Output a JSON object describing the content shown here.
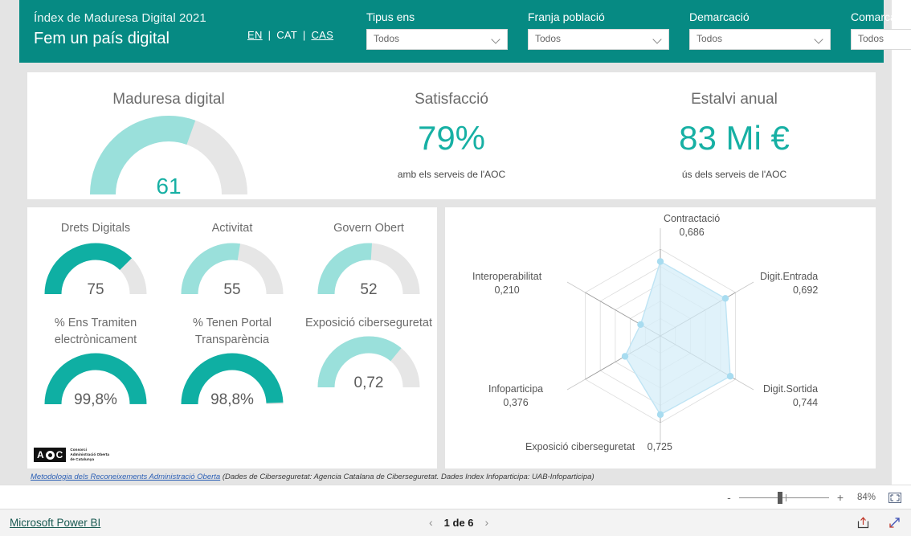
{
  "header": {
    "subtitle": "Índex de Maduresa Digital 2021",
    "title": "Fem un país digital",
    "languages": [
      {
        "code": "EN",
        "active": true
      },
      {
        "code": "CAT",
        "active": false
      },
      {
        "code": "CAS",
        "active": true
      }
    ],
    "separator": "|",
    "brand_color": "#068a83",
    "filters": [
      {
        "label": "Tipus ens",
        "value": "Todos"
      },
      {
        "label": "Franja població",
        "value": "Todos"
      },
      {
        "label": "Demarcació",
        "value": "Todos"
      },
      {
        "label": "Comarca",
        "value": "Todos"
      }
    ]
  },
  "kpis": [
    {
      "title": "Maduresa digital",
      "type": "gauge",
      "value": 61,
      "display": "61",
      "percent": 61,
      "color": "#9ae0db"
    },
    {
      "title": "Satisfacció",
      "type": "number",
      "display": "79%",
      "note": "amb els serveis de l'AOC",
      "color": "#17b0a4"
    },
    {
      "title": "Estalvi anual",
      "type": "number",
      "display": "83 Mi €",
      "note": "ús dels serveis de l'AOC",
      "color": "#17b0a4"
    }
  ],
  "gauges": [
    {
      "title": "Drets Digitals",
      "display": "75",
      "percent": 75,
      "color": "#0fafa3"
    },
    {
      "title": "Activitat",
      "display": "55",
      "percent": 55,
      "color": "#9ae0db"
    },
    {
      "title": "Govern Obert",
      "display": "52",
      "percent": 52,
      "color": "#9ae0db"
    },
    {
      "title": "% Ens Tramiten electrònicament",
      "display": "99,8%",
      "percent": 99.8,
      "color": "#0fafa3"
    },
    {
      "title": "% Tenen Portal Transparència",
      "display": "98,8%",
      "percent": 98.8,
      "color": "#0fafa3"
    },
    {
      "title": "Exposició ciberseguretat",
      "display": "0,72",
      "percent": 72,
      "color": "#9ae0db"
    }
  ],
  "logo": {
    "letters": [
      "A",
      "C"
    ],
    "line1": "Consorci",
    "line2": "Administració Oberta",
    "line3": "de Catalunya"
  },
  "footnote": {
    "link": "Metodologia dels Reconeixements Administració Oberta",
    "rest": " (Dades de Ciberseguretat: Agencia Catalana de Ciberseguretat. Dades Index Infoparticipa: UAB-Infoparticipa)"
  },
  "chart_data": {
    "type": "radar",
    "title": "",
    "categories": [
      "Contractació",
      "Digit.Entrada",
      "Digit.Sortida",
      "Exposició ciberseguretat",
      "Infoparticipa",
      "Interoperabilitat"
    ],
    "values": [
      0.686,
      0.692,
      0.744,
      0.725,
      0.376,
      0.21
    ],
    "labels": [
      "0,686",
      "0,692",
      "0,744",
      "0,725",
      "0,376",
      "0,210"
    ],
    "rmax": 0.8,
    "rings": 5,
    "grid": true,
    "legend": "none",
    "fill_color": "#d6eef8",
    "line_color": "#bfe4f4",
    "marker_color": "#a8dcf0"
  },
  "zoombar": {
    "minus": "-",
    "plus": "+",
    "percent": "84%"
  },
  "statusbar": {
    "product": "Microsoft Power BI",
    "prev": "‹",
    "next": "›",
    "page": "1 de 6"
  }
}
